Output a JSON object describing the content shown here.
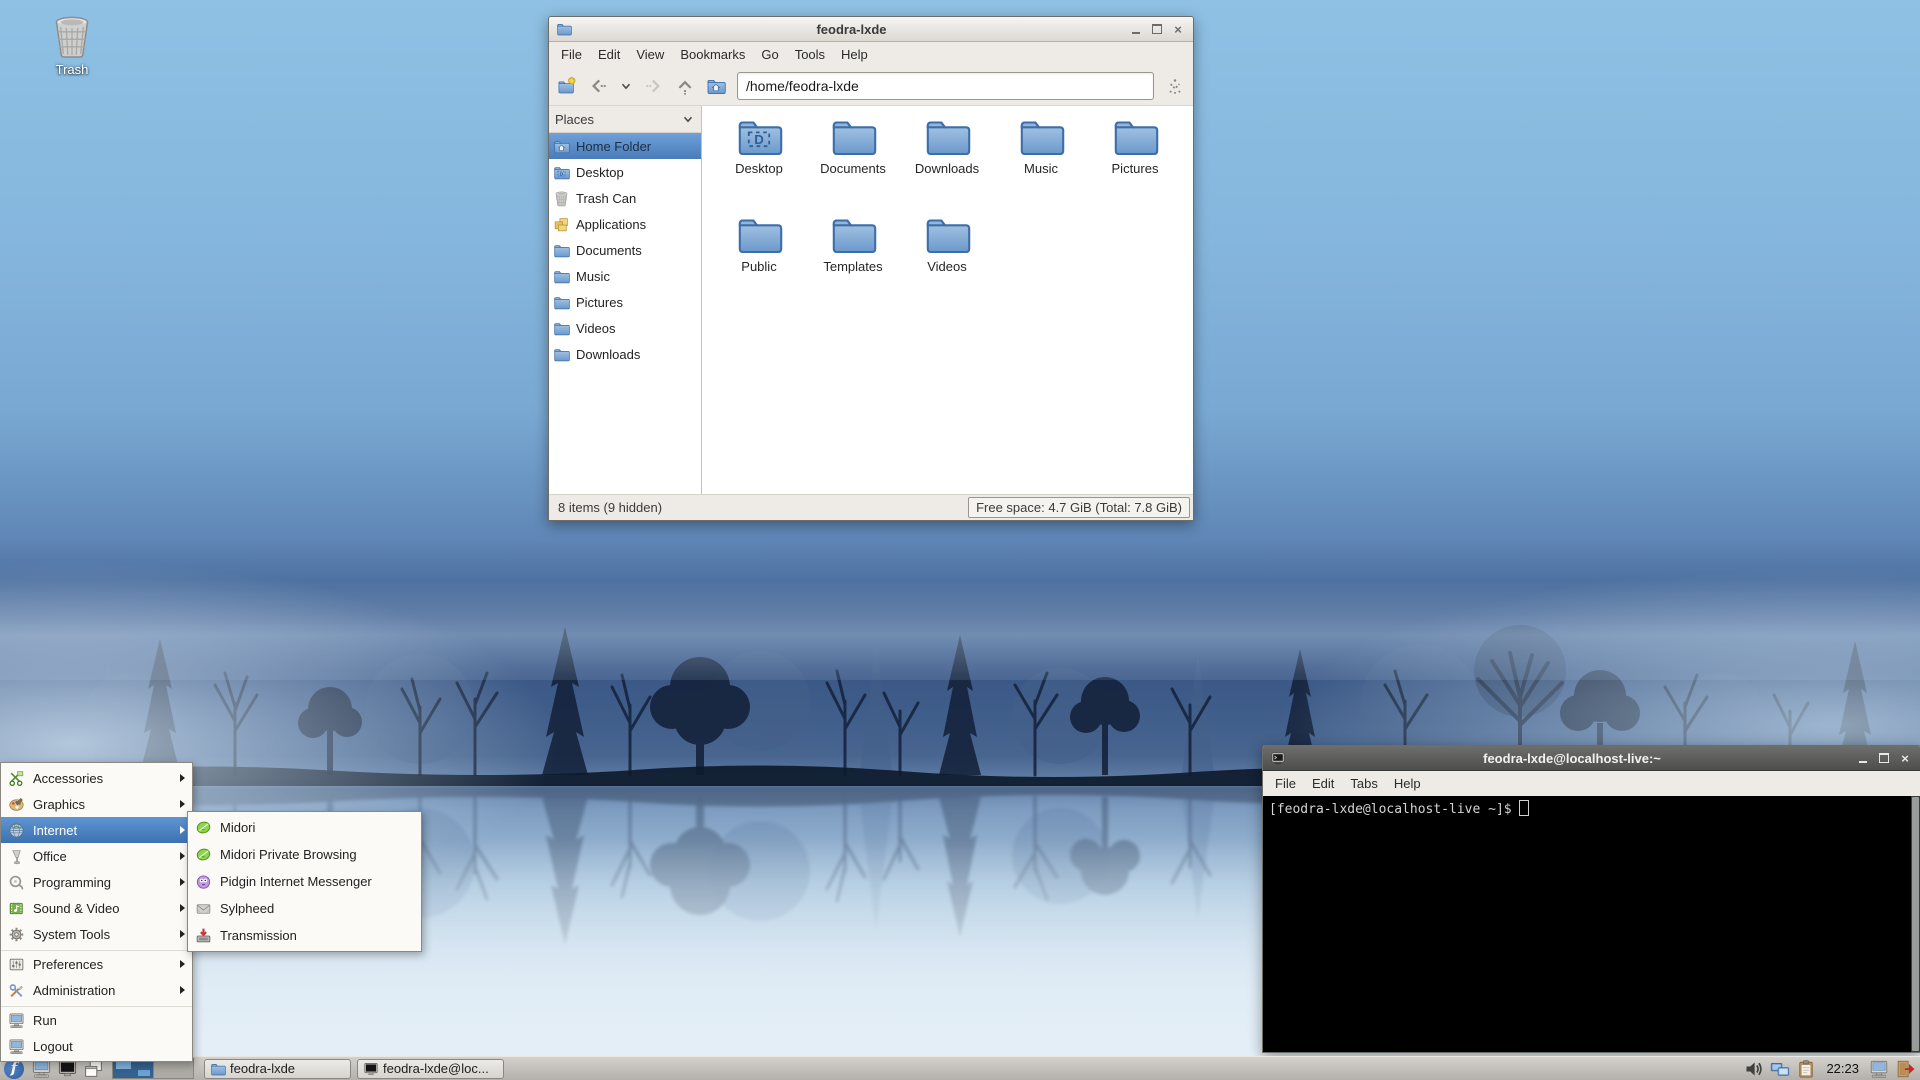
{
  "desktop": {
    "trash_label": "Trash"
  },
  "colors": {
    "selection_blue": "#4a7cba",
    "folder_blue": "#6b99cc",
    "wallpaper_top": "#8ec1e4",
    "terminal_bg": "#000000",
    "fedora_blue": "#3c6eb4"
  },
  "file_manager": {
    "title": "feodra-lxde",
    "menu": [
      "File",
      "Edit",
      "View",
      "Bookmarks",
      "Go",
      "Tools",
      "Help"
    ],
    "path": "/home/feodra-lxde",
    "places_header": "Places",
    "places": [
      {
        "label": "Home Folder",
        "icon": "folder-home",
        "selected": true
      },
      {
        "label": "Desktop",
        "icon": "folder-desktop"
      },
      {
        "label": "Trash Can",
        "icon": "trash"
      },
      {
        "label": "Applications",
        "icon": "applications"
      },
      {
        "label": "Documents",
        "icon": "folder"
      },
      {
        "label": "Music",
        "icon": "folder"
      },
      {
        "label": "Pictures",
        "icon": "folder"
      },
      {
        "label": "Videos",
        "icon": "folder"
      },
      {
        "label": "Downloads",
        "icon": "folder"
      }
    ],
    "folders": [
      {
        "label": "Desktop",
        "icon": "folder-desktop"
      },
      {
        "label": "Documents",
        "icon": "folder"
      },
      {
        "label": "Downloads",
        "icon": "folder"
      },
      {
        "label": "Music",
        "icon": "folder"
      },
      {
        "label": "Pictures",
        "icon": "folder"
      },
      {
        "label": "Public",
        "icon": "folder"
      },
      {
        "label": "Templates",
        "icon": "folder"
      },
      {
        "label": "Videos",
        "icon": "folder"
      }
    ],
    "status_left": "8 items (9 hidden)",
    "status_right": "Free space: 4.7 GiB (Total: 7.8 GiB)"
  },
  "terminal": {
    "title": "feodra-lxde@localhost-live:~",
    "menu": [
      "File",
      "Edit",
      "Tabs",
      "Help"
    ],
    "prompt": "[feodra-lxde@localhost-live ~]$"
  },
  "app_menu": {
    "items": [
      {
        "label": "Accessories",
        "icon": "accessories",
        "submenu": true
      },
      {
        "label": "Graphics",
        "icon": "graphics",
        "submenu": true
      },
      {
        "label": "Internet",
        "icon": "internet",
        "submenu": true,
        "highlighted": true
      },
      {
        "label": "Office",
        "icon": "office",
        "submenu": true
      },
      {
        "label": "Programming",
        "icon": "programming",
        "submenu": true
      },
      {
        "label": "Sound & Video",
        "icon": "sound-video",
        "submenu": true
      },
      {
        "label": "System Tools",
        "icon": "system-tools",
        "submenu": true
      },
      {
        "label": "Preferences",
        "icon": "preferences",
        "submenu": true,
        "sep": true
      },
      {
        "label": "Administration",
        "icon": "administration",
        "submenu": true
      },
      {
        "label": "Run",
        "icon": "run",
        "sep": true
      },
      {
        "label": "Logout",
        "icon": "logout"
      }
    ]
  },
  "internet_submenu": {
    "items": [
      {
        "label": "Midori",
        "icon": "midori"
      },
      {
        "label": "Midori Private Browsing",
        "icon": "midori"
      },
      {
        "label": "Pidgin Internet Messenger",
        "icon": "pidgin"
      },
      {
        "label": "Sylpheed",
        "icon": "sylpheed"
      },
      {
        "label": "Transmission",
        "icon": "transmission"
      }
    ]
  },
  "taskbar": {
    "launchers": [
      {
        "icon": "monitor",
        "name": "file-manager-launcher-icon"
      },
      {
        "icon": "monitor-dark",
        "name": "terminal-launcher-icon"
      },
      {
        "icon": "windows",
        "name": "iconify-all-windows-icon"
      }
    ],
    "tasks": [
      {
        "label": "feodra-lxde",
        "icon": "folder"
      },
      {
        "label": "feodra-lxde@loc...",
        "icon": "monitor-dark"
      }
    ],
    "tray_icons": [
      "volume",
      "network",
      "clipboard"
    ],
    "clock": "22:23",
    "tray_icons_right": [
      "monitor",
      "logout"
    ]
  }
}
